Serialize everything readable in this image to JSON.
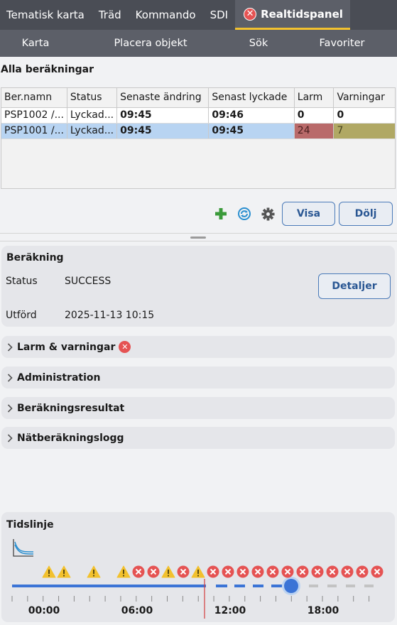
{
  "tabs": [
    {
      "label": "Tematisk karta",
      "active": false
    },
    {
      "label": "Träd",
      "active": false
    },
    {
      "label": "Kommando",
      "active": false
    },
    {
      "label": "SDI",
      "active": false
    },
    {
      "label": "Realtidspanel",
      "active": true,
      "icon": "error-badge-icon"
    }
  ],
  "subnav": [
    "Karta",
    "Placera objekt",
    "Sök",
    "Favoriter"
  ],
  "list": {
    "title": "Alla beräkningar",
    "columns": [
      "Ber.namn",
      "Status",
      "Senaste ändring",
      "Senast lyckade",
      "Larm",
      "Varningar"
    ],
    "rows": [
      {
        "name": "PSP1002 /...",
        "status": "Lyckad...",
        "changed": "09:45",
        "last_ok": "09:46",
        "alarms": "0",
        "warnings": "0",
        "selected": false
      },
      {
        "name": "PSP1001 /...",
        "status": "Lyckad...",
        "changed": "09:45",
        "last_ok": "09:45",
        "alarms": "24",
        "warnings": "7",
        "selected": true
      }
    ]
  },
  "toolbar": {
    "icons": [
      "add-icon",
      "refresh-icon",
      "settings-gear-icon"
    ],
    "show_label": "Visa",
    "hide_label": "Dölj"
  },
  "calc": {
    "title": "Beräkning",
    "status_label": "Status",
    "status_value": "SUCCESS",
    "done_label": "Utförd",
    "done_value": "2025-11-13 10:15",
    "details_label": "Detaljer"
  },
  "sections": [
    {
      "label": "Larm & varningar",
      "badge": "error"
    },
    {
      "label": "Administration"
    },
    {
      "label": "Beräkningsresultat"
    },
    {
      "label": "Nätberäkningslogg"
    }
  ],
  "timeline": {
    "title": "Tidslinje",
    "time_labels": [
      "00:00",
      "06:00",
      "12:00",
      "18:00"
    ],
    "events": [
      "warning",
      "warning",
      "warning",
      "warning",
      "error",
      "error",
      "warning",
      "error",
      "warning",
      "error",
      "error",
      "error",
      "error",
      "error",
      "error",
      "error",
      "error",
      "error",
      "error",
      "error",
      "error",
      "error"
    ],
    "colors": {
      "progress": "#3b74d6",
      "future": "#c3c3c3",
      "now_marker": "#d33c3c",
      "warning": "#f2c12e",
      "error": "#e55353"
    }
  }
}
